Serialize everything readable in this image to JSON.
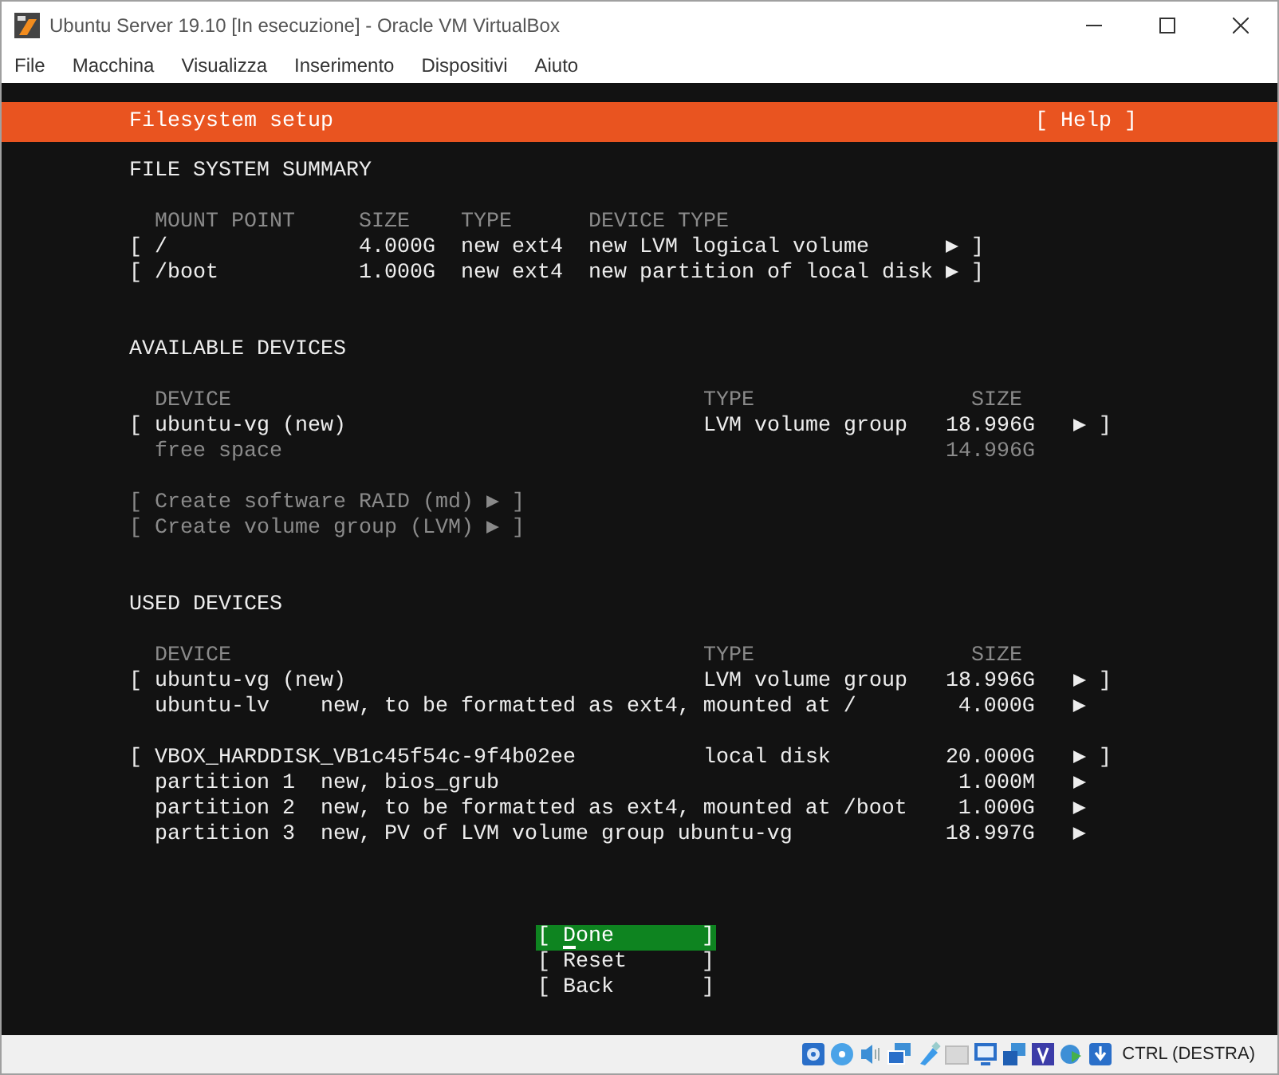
{
  "window": {
    "title": "Ubuntu Server 19.10 [In esecuzione] - Oracle VM VirtualBox"
  },
  "menu": [
    "File",
    "Macchina",
    "Visualizza",
    "Inserimento",
    "Dispositivi",
    "Aiuto"
  ],
  "terminal": {
    "header": {
      "title": "Filesystem setup",
      "help": "[ Help ]"
    },
    "summary": {
      "heading": "FILE SYSTEM SUMMARY",
      "columns": [
        "MOUNT POINT",
        "SIZE",
        "TYPE",
        "DEVICE TYPE"
      ],
      "rows": [
        {
          "open": "[",
          "mount": "/",
          "size": "4.000G",
          "type": "new ext4",
          "device_type": "new LVM logical volume",
          "arrow": "▶",
          "close": "]"
        },
        {
          "open": "[",
          "mount": "/boot",
          "size": "1.000G",
          "type": "new ext4",
          "device_type": "new partition of local disk",
          "arrow": "▶",
          "close": "]"
        }
      ]
    },
    "available": {
      "heading": "AVAILABLE DEVICES",
      "columns": [
        "DEVICE",
        "TYPE",
        "SIZE"
      ],
      "devices": [
        {
          "open": "[",
          "name": "ubuntu-vg (new)",
          "type": "LVM volume group",
          "size": "18.996G",
          "arrow": "▶",
          "close": "]",
          "children": [
            {
              "name": "free space",
              "size": "14.996G",
              "disabled": true
            }
          ]
        }
      ],
      "actions": [
        {
          "label": "[ Create software RAID (md) ▶ ]",
          "disabled": true
        },
        {
          "label": "[ Create volume group (LVM) ▶ ]",
          "disabled": true
        }
      ]
    },
    "used": {
      "heading": "USED DEVICES",
      "columns": [
        "DEVICE",
        "TYPE",
        "SIZE"
      ],
      "devices": [
        {
          "open": "[",
          "name": "ubuntu-vg (new)",
          "type": "LVM volume group",
          "size": "18.996G",
          "arrow": "▶",
          "close": "]",
          "children": [
            {
              "name": "ubuntu-lv",
              "description": "new, to be formatted as ext4, mounted at /",
              "size": "4.000G",
              "arrow": "▶",
              "disabled": false
            }
          ]
        },
        {
          "open": "[",
          "name": "VBOX_HARDDISK_VB1c45f54c-9f4b02ee",
          "type": "local disk",
          "size": "20.000G",
          "arrow": "▶",
          "close": "]",
          "children": [
            {
              "name": "partition 1",
              "description": "new, bios_grub",
              "size": "1.000M",
              "arrow": "▶",
              "disabled": false
            },
            {
              "name": "partition 2",
              "description": "new, to be formatted as ext4, mounted at /boot",
              "size": "1.000G",
              "arrow": "▶",
              "disabled": false
            },
            {
              "name": "partition 3",
              "description": "new, PV of LVM volume group ubuntu-vg",
              "size": "18.997G",
              "arrow": "▶",
              "disabled": false
            }
          ]
        }
      ]
    },
    "buttons": [
      {
        "open": "[",
        "label": "Done",
        "close": "]",
        "selected": true
      },
      {
        "open": "[",
        "label": "Reset",
        "close": "]",
        "selected": false
      },
      {
        "open": "[",
        "label": "Back",
        "close": "]",
        "selected": false
      }
    ]
  },
  "status_bar": {
    "host_key": "CTRL (DESTRA)"
  }
}
